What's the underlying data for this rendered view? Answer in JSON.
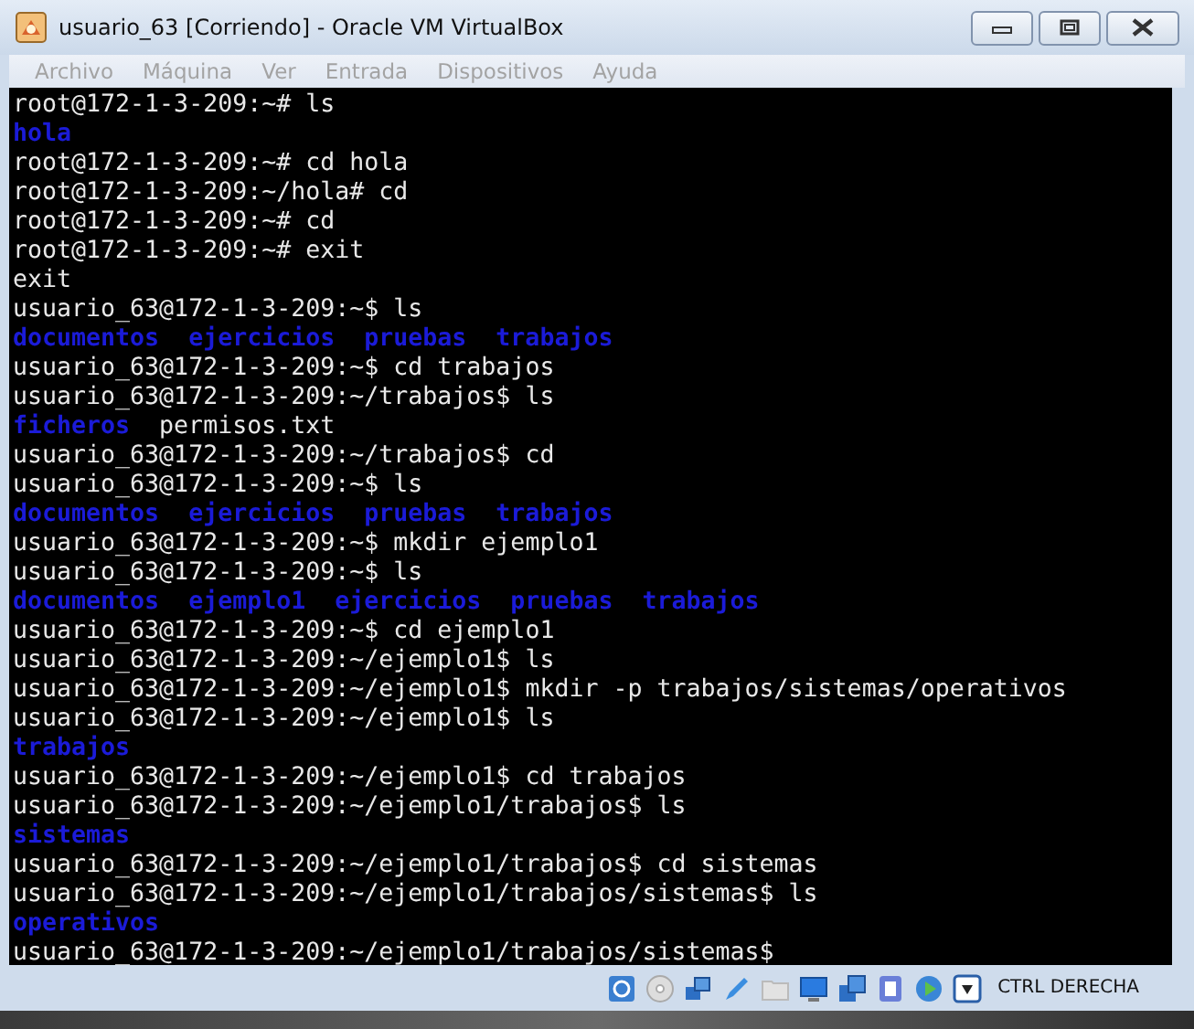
{
  "window": {
    "title": "usuario_63 [Corriendo] - Oracle VM VirtualBox"
  },
  "menu": [
    {
      "label": "Archivo",
      "disabled": true
    },
    {
      "label": "Máquina",
      "disabled": true
    },
    {
      "label": "Ver",
      "disabled": true
    },
    {
      "label": "Entrada",
      "disabled": true
    },
    {
      "label": "Dispositivos",
      "disabled": true
    },
    {
      "label": "Ayuda",
      "disabled": true
    }
  ],
  "terminal": {
    "lines": [
      [
        {
          "text": "root@172-1-3-209:~# ls",
          "kind": "text"
        }
      ],
      [
        {
          "text": "hola",
          "kind": "dir"
        }
      ],
      [
        {
          "text": "root@172-1-3-209:~# cd hola",
          "kind": "text"
        }
      ],
      [
        {
          "text": "root@172-1-3-209:~/hola# cd",
          "kind": "text"
        }
      ],
      [
        {
          "text": "root@172-1-3-209:~# cd",
          "kind": "text"
        }
      ],
      [
        {
          "text": "root@172-1-3-209:~# exit",
          "kind": "text"
        }
      ],
      [
        {
          "text": "exit",
          "kind": "text"
        }
      ],
      [
        {
          "text": "usuario_63@172-1-3-209:~$ ls",
          "kind": "text"
        }
      ],
      [
        {
          "text": "documentos",
          "kind": "dir"
        },
        {
          "text": "ejercicios",
          "kind": "dir"
        },
        {
          "text": "pruebas",
          "kind": "dir"
        },
        {
          "text": "trabajos",
          "kind": "dir"
        }
      ],
      [
        {
          "text": "usuario_63@172-1-3-209:~$ cd trabajos",
          "kind": "text"
        }
      ],
      [
        {
          "text": "usuario_63@172-1-3-209:~/trabajos$ ls",
          "kind": "text"
        }
      ],
      [
        {
          "text": "ficheros",
          "kind": "dir"
        },
        {
          "text": "permisos.txt",
          "kind": "file"
        }
      ],
      [
        {
          "text": "usuario_63@172-1-3-209:~/trabajos$ cd",
          "kind": "text"
        }
      ],
      [
        {
          "text": "usuario_63@172-1-3-209:~$ ls",
          "kind": "text"
        }
      ],
      [
        {
          "text": "documentos",
          "kind": "dir"
        },
        {
          "text": "ejercicios",
          "kind": "dir"
        },
        {
          "text": "pruebas",
          "kind": "dir"
        },
        {
          "text": "trabajos",
          "kind": "dir"
        }
      ],
      [
        {
          "text": "usuario_63@172-1-3-209:~$ mkdir ejemplo1",
          "kind": "text"
        }
      ],
      [
        {
          "text": "usuario_63@172-1-3-209:~$ ls",
          "kind": "text"
        }
      ],
      [
        {
          "text": "documentos",
          "kind": "dir"
        },
        {
          "text": "ejemplo1",
          "kind": "dir"
        },
        {
          "text": "ejercicios",
          "kind": "dir"
        },
        {
          "text": "pruebas",
          "kind": "dir"
        },
        {
          "text": "trabajos",
          "kind": "dir"
        }
      ],
      [
        {
          "text": "usuario_63@172-1-3-209:~$ cd ejemplo1",
          "kind": "text"
        }
      ],
      [
        {
          "text": "usuario_63@172-1-3-209:~/ejemplo1$ ls",
          "kind": "text"
        }
      ],
      [
        {
          "text": "usuario_63@172-1-3-209:~/ejemplo1$ mkdir -p trabajos/sistemas/operativos",
          "kind": "text"
        }
      ],
      [
        {
          "text": "usuario_63@172-1-3-209:~/ejemplo1$ ls",
          "kind": "text"
        }
      ],
      [
        {
          "text": "trabajos",
          "kind": "dir"
        }
      ],
      [
        {
          "text": "usuario_63@172-1-3-209:~/ejemplo1$ cd trabajos",
          "kind": "text"
        }
      ],
      [
        {
          "text": "usuario_63@172-1-3-209:~/ejemplo1/trabajos$ ls",
          "kind": "text"
        }
      ],
      [
        {
          "text": "sistemas",
          "kind": "dir"
        }
      ],
      [
        {
          "text": "usuario_63@172-1-3-209:~/ejemplo1/trabajos$ cd sistemas",
          "kind": "text"
        }
      ],
      [
        {
          "text": "usuario_63@172-1-3-209:~/ejemplo1/trabajos/sistemas$ ls",
          "kind": "text"
        }
      ],
      [
        {
          "text": "operativos",
          "kind": "dir"
        }
      ],
      [
        {
          "text": "usuario_63@172-1-3-209:~/ejemplo1/trabajos/sistemas$",
          "kind": "text"
        }
      ]
    ]
  },
  "status_bar": {
    "host_key": "CTRL DERECHA"
  }
}
